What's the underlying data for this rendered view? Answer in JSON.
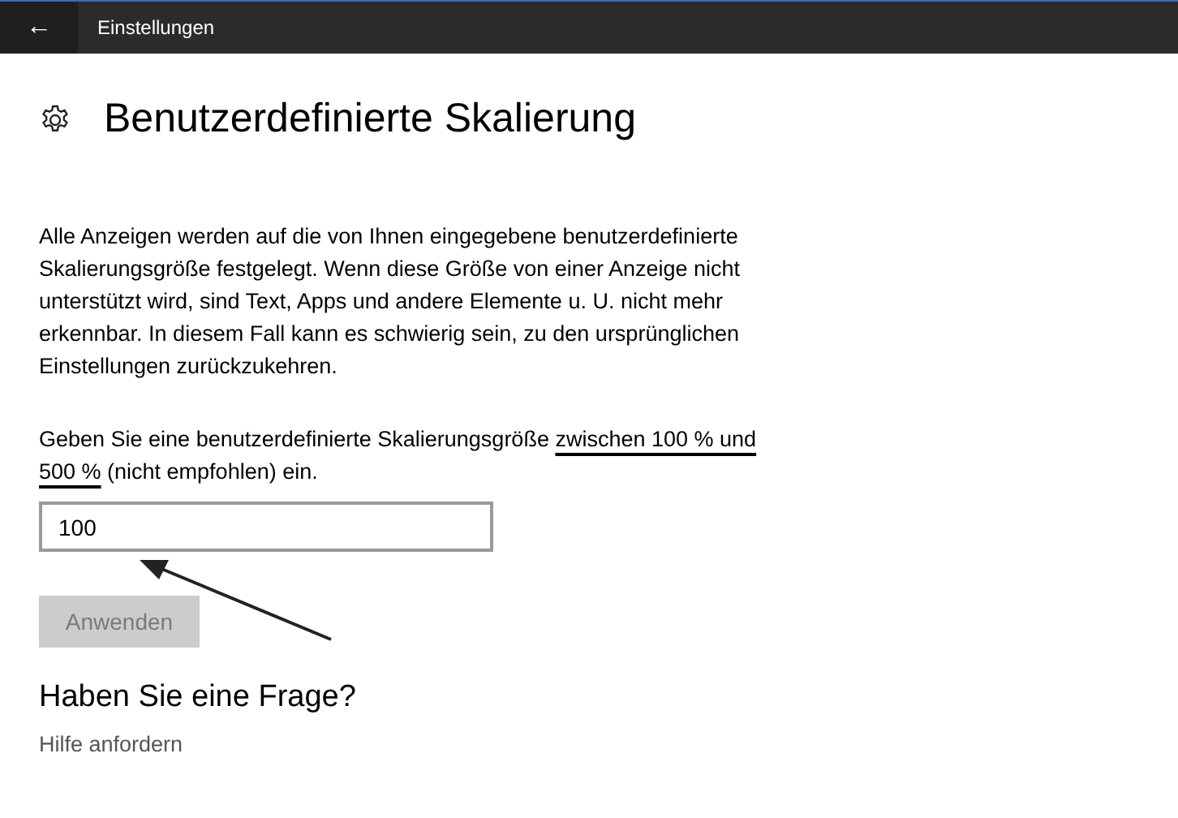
{
  "title_bar": {
    "back_icon": "←",
    "title": "Einstellungen"
  },
  "page": {
    "heading": "Benutzerdefinierte Skalierung",
    "description": "Alle Anzeigen werden auf die von Ihnen eingegebene benutzerdefinierte Skalierungsgröße festgelegt. Wenn diese Größe von einer Anzeige nicht unterstützt wird, sind Text, Apps und andere Elemente u. U. nicht mehr erkennbar. In diesem Fall kann es schwierig sein, zu den ursprünglichen Einstellungen zurückzukehren.",
    "instruction": {
      "before": "Geben Sie eine benutzerdefinierte Skalierungsgröße ",
      "underlined": "zwischen 100 % und 500 %",
      "after": " (nicht empfohlen) ein."
    },
    "scale_field": {
      "value": "100"
    },
    "apply_button": {
      "label": "Anwenden",
      "disabled": true
    }
  },
  "help": {
    "heading": "Haben Sie eine Frage?",
    "link": "Hilfe anfordern"
  }
}
